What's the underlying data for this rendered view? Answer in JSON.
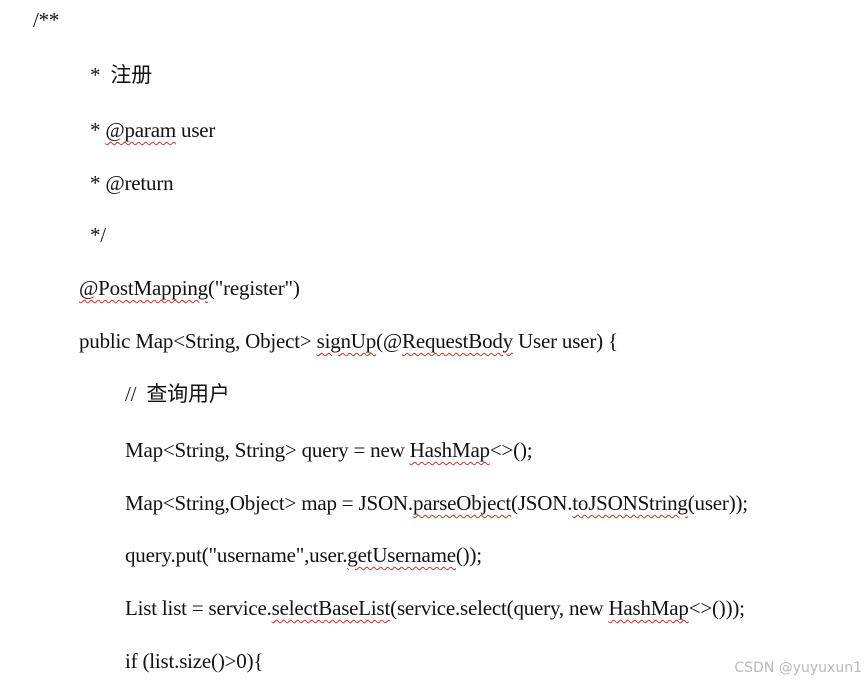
{
  "document": {
    "lines": [
      {
        "segments": [
          {
            "text": "/**"
          }
        ]
      },
      {
        "segments": [
          {
            "text": "*  注册"
          }
        ]
      },
      {
        "segments": [
          {
            "text": "* "
          },
          {
            "text": "@param",
            "squiggle": true
          },
          {
            "text": " user"
          }
        ]
      },
      {
        "segments": [
          {
            "text": "* @return"
          }
        ]
      },
      {
        "segments": [
          {
            "text": "*/"
          }
        ]
      },
      {
        "segments": [
          {
            "text": "@PostMapping",
            "squiggle": true
          },
          {
            "text": "(\"register\")"
          }
        ]
      },
      {
        "segments": [
          {
            "text": "public Map<String, Object> "
          },
          {
            "text": "signUp",
            "squiggle": true
          },
          {
            "text": "(@"
          },
          {
            "text": "RequestBody",
            "squiggle": true
          },
          {
            "text": " User user) {"
          }
        ]
      },
      {
        "segments": [
          {
            "text": "//  查询用户"
          }
        ]
      },
      {
        "segments": [
          {
            "text": "Map<String, String> query = new "
          },
          {
            "text": "HashMap",
            "squiggle": true
          },
          {
            "text": "<>();"
          }
        ]
      },
      {
        "segments": [
          {
            "text": "Map<String,Object> map = JSON."
          },
          {
            "text": "parseObject",
            "squiggle": true
          },
          {
            "text": "(JSON."
          },
          {
            "text": "toJSONString",
            "squiggle": true
          },
          {
            "text": "(user));"
          }
        ]
      },
      {
        "segments": [
          {
            "text": "query.put(\"username\",user."
          },
          {
            "text": "getUsername",
            "squiggle": true
          },
          {
            "text": "());"
          }
        ]
      },
      {
        "segments": [
          {
            "text": "List list = service."
          },
          {
            "text": "selectBaseList",
            "squiggle": true
          },
          {
            "text": "(service.select(query, new "
          },
          {
            "text": "HashMap",
            "squiggle": true
          },
          {
            "text": "<>()));"
          }
        ]
      },
      {
        "segments": [
          {
            "text": "if (list.size()>0){"
          }
        ]
      }
    ]
  },
  "watermark": {
    "text": "CSDN @yuyuxun1"
  }
}
